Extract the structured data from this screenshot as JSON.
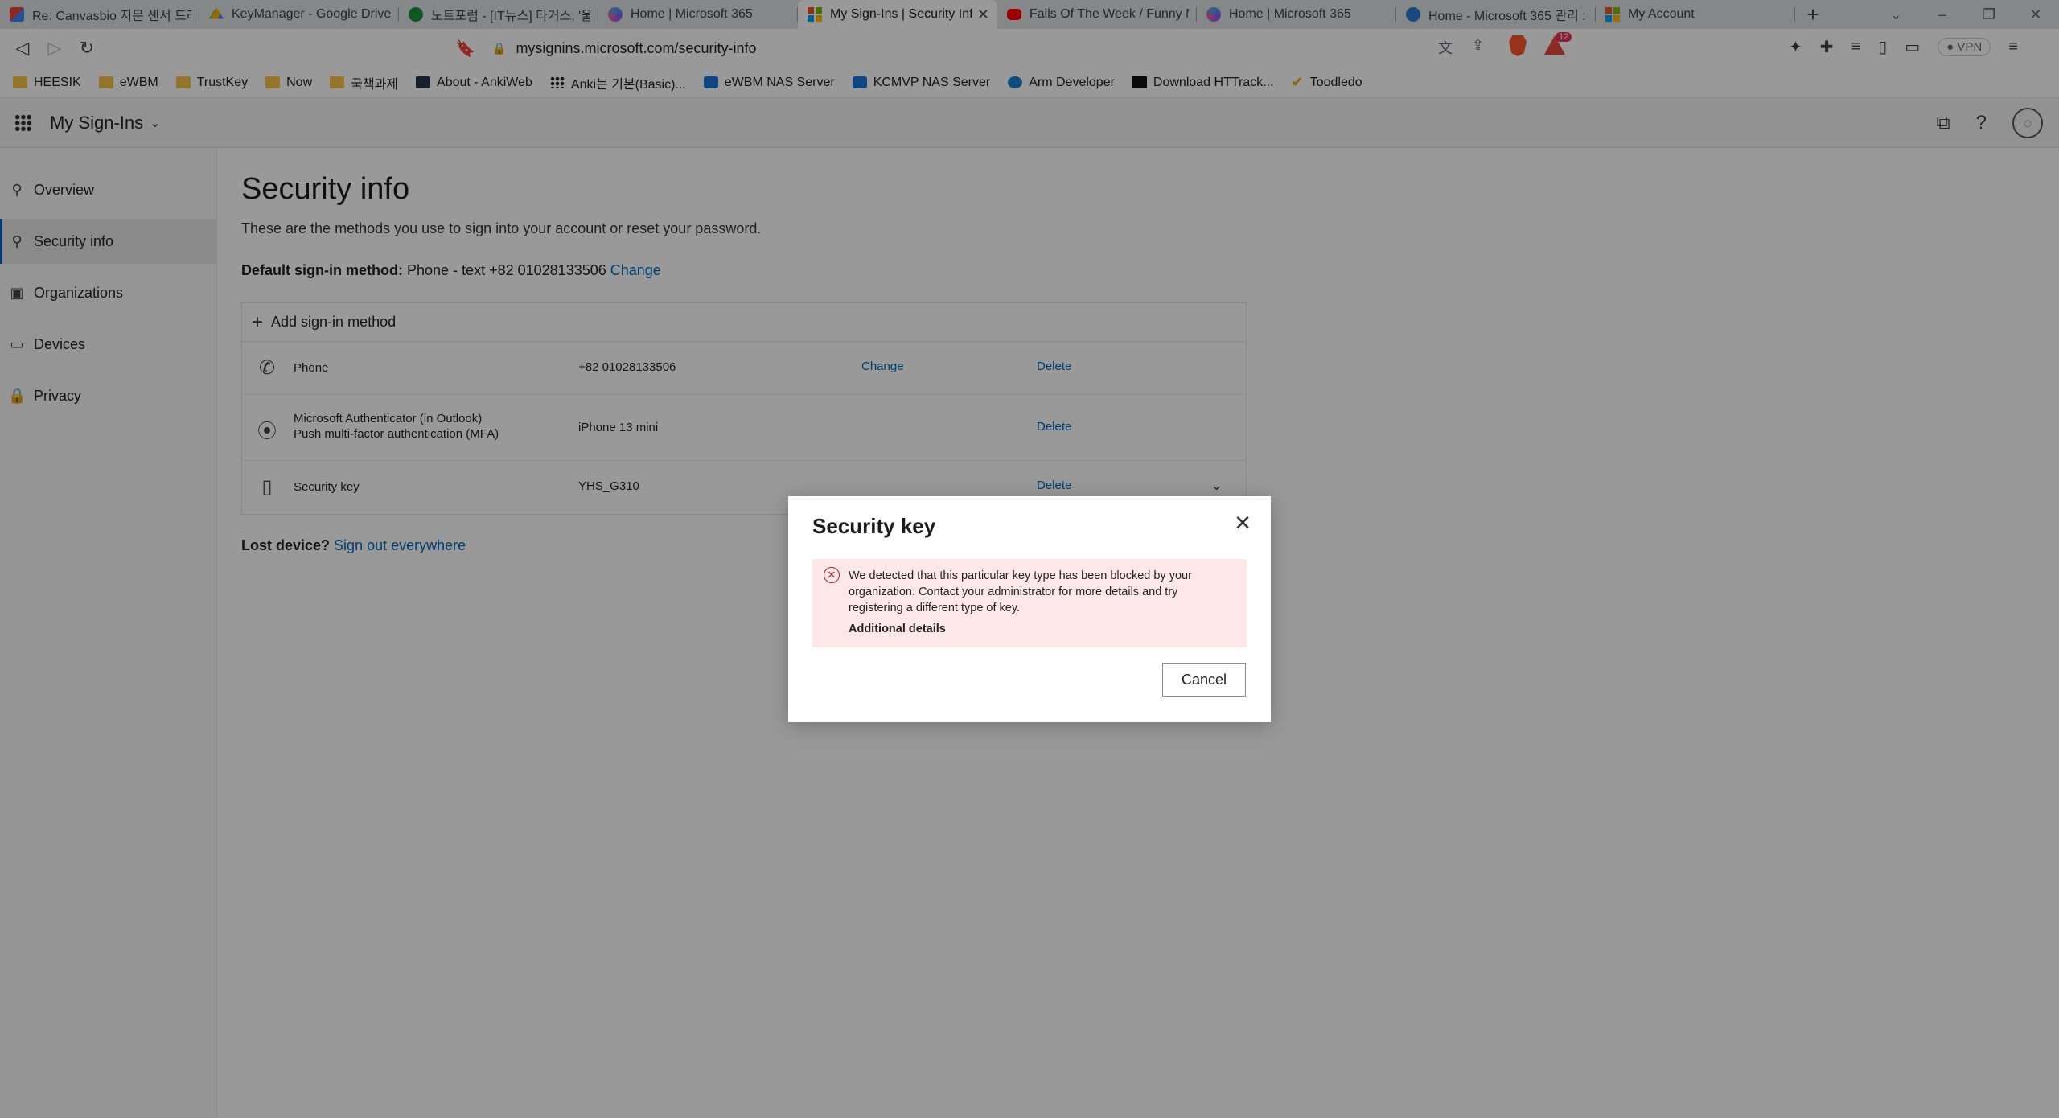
{
  "browser": {
    "tabs": [
      {
        "title": "Re: Canvasbio 지문 센서 드라",
        "favicon": "gmail-icon"
      },
      {
        "title": "KeyManager - Google Drive",
        "favicon": "drive-icon"
      },
      {
        "title": "노트포럼 - [IT뉴스] 타거스, '울",
        "favicon": "forum-icon"
      },
      {
        "title": "Home | Microsoft 365",
        "favicon": "m365-icon"
      },
      {
        "title": "My Sign-Ins | Security Inf",
        "favicon": "microsoft-icon",
        "active": true
      },
      {
        "title": "Fails Of The Week / Funny M",
        "favicon": "youtube-icon"
      },
      {
        "title": "Home | Microsoft 365",
        "favicon": "m365-icon"
      },
      {
        "title": "Home - Microsoft 365 관리 :",
        "favicon": "admin-icon"
      },
      {
        "title": "My Account",
        "favicon": "microsoft-icon"
      }
    ],
    "url": "mysignins.microsoft.com/security-info",
    "rewards_count": "12",
    "vpn_label": "VPN",
    "bookmarks": [
      {
        "label": "HEESIK",
        "icon": "folder-icon"
      },
      {
        "label": "eWBM",
        "icon": "folder-icon"
      },
      {
        "label": "TrustKey",
        "icon": "folder-icon"
      },
      {
        "label": "Now",
        "icon": "folder-icon"
      },
      {
        "label": "국책과제",
        "icon": "folder-icon"
      },
      {
        "label": "About - AnkiWeb",
        "icon": "anki-icon"
      },
      {
        "label": "Anki는 기본(Basic)...",
        "icon": "dots-icon"
      },
      {
        "label": "eWBM NAS Server",
        "icon": "dsm-icon"
      },
      {
        "label": "KCMVP NAS Server",
        "icon": "dsm-icon"
      },
      {
        "label": "Arm Developer",
        "icon": "arm-icon"
      },
      {
        "label": "Download HTTrack...",
        "icon": "httrack-icon"
      },
      {
        "label": "Toodledo",
        "icon": "check-icon"
      }
    ]
  },
  "header": {
    "app_name": "My Sign-Ins"
  },
  "nav": {
    "items": [
      {
        "label": "Overview",
        "icon": "person-icon"
      },
      {
        "label": "Security info",
        "icon": "person-key-icon",
        "active": true
      },
      {
        "label": "Organizations",
        "icon": "briefcase-icon"
      },
      {
        "label": "Devices",
        "icon": "laptop-icon"
      },
      {
        "label": "Privacy",
        "icon": "lock-icon"
      }
    ]
  },
  "main": {
    "title": "Security info",
    "subtitle": "These are the methods you use to sign into your account or reset your password.",
    "default_method_label": "Default sign-in method:",
    "default_method_value": "Phone - text +82 01028133506",
    "default_method_change": "Change",
    "add_method_label": "Add sign-in method",
    "methods": [
      {
        "icon": "phone-icon",
        "name": "Phone",
        "subname": "",
        "detail": "+82 01028133506",
        "change": "Change",
        "delete": "Delete"
      },
      {
        "icon": "authenticator-icon",
        "name": "Microsoft Authenticator (in Outlook)",
        "subname": "Push multi-factor authentication (MFA)",
        "detail": "iPhone 13 mini",
        "change": "",
        "delete": "Delete"
      },
      {
        "icon": "usb-key-icon",
        "name": "Security key",
        "subname": "",
        "detail": "YHS_G310",
        "change": "",
        "delete": "Delete"
      }
    ],
    "lost_device_label": "Lost device?",
    "lost_device_link": "Sign out everywhere"
  },
  "dialog": {
    "title": "Security key",
    "error_message": "We detected that this particular key type has been blocked by your organization. Contact your administrator for more details and try registering a different type of key.",
    "error_details_label": "Additional details",
    "cancel_label": "Cancel"
  },
  "colors": {
    "accent": "#0067b8",
    "error_background": "#fde7e9",
    "error_icon": "#a4262c"
  }
}
